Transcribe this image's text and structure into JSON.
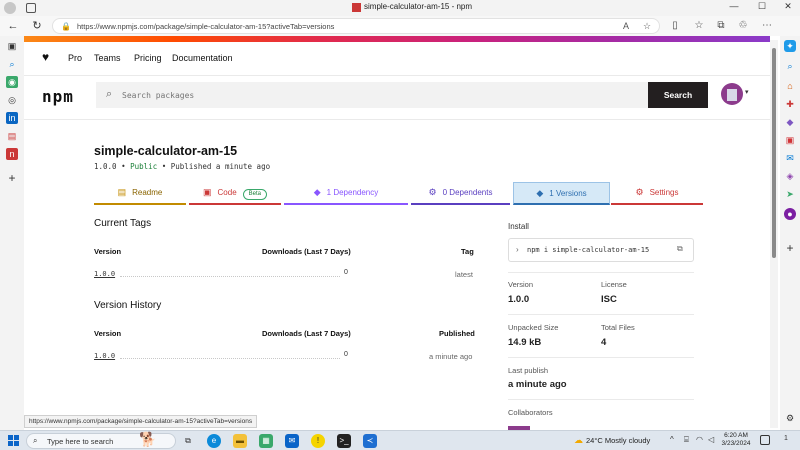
{
  "browser": {
    "tab_title": "simple-calculator-am-15 - npm",
    "url": "https://www.npmjs.com/package/simple-calculator-am-15?activeTab=versions",
    "status_url": "https://www.npmjs.com/package/simple-calculator-am-15?activeTab=versions"
  },
  "npm_nav": {
    "links": [
      "Pro",
      "Teams",
      "Pricing",
      "Documentation"
    ],
    "logo": "npm",
    "search_placeholder": "Search packages",
    "search_button": "Search"
  },
  "package": {
    "name": "simple-calculator-am-15",
    "version": "1.0.0",
    "visibility": "Public",
    "published": "Published a minute ago"
  },
  "tabs": [
    {
      "label": "Readme",
      "icon": "readme-icon",
      "color": "#c28b00"
    },
    {
      "label": "Code",
      "icon": "code-icon",
      "color": "#cb3837",
      "badge": "Beta"
    },
    {
      "label": "1 Dependency",
      "icon": "dependency-icon",
      "color": "#8956ff"
    },
    {
      "label": "0 Dependents",
      "icon": "dependents-icon",
      "color": "#5a3fc0"
    },
    {
      "label": "1 Versions",
      "icon": "versions-icon",
      "color": "#2e6fb0",
      "active": true
    },
    {
      "label": "Settings",
      "icon": "settings-icon",
      "color": "#cb3837"
    }
  ],
  "current_tags": {
    "title": "Current Tags",
    "headers": [
      "Version",
      "Downloads (Last 7 Days)",
      "Tag"
    ],
    "rows": [
      {
        "version": "1.0.0",
        "downloads": "0",
        "tag": "latest"
      }
    ]
  },
  "version_history": {
    "title": "Version History",
    "headers": [
      "Version",
      "Downloads (Last 7 Days)",
      "Published"
    ],
    "rows": [
      {
        "version": "1.0.0",
        "downloads": "0",
        "published": "a minute ago"
      }
    ]
  },
  "sidebar": {
    "install_label": "Install",
    "install_cmd": "npm i simple-calculator-am-15",
    "version_label": "Version",
    "version_value": "1.0.0",
    "license_label": "License",
    "license_value": "ISC",
    "unpacked_label": "Unpacked Size",
    "unpacked_value": "14.9 kB",
    "files_label": "Total Files",
    "files_value": "4",
    "last_publish_label": "Last publish",
    "last_publish_value": "a minute ago",
    "collaborators_label": "Collaborators"
  },
  "taskbar": {
    "search_placeholder": "Type here to search",
    "weather": "24°C  Mostly cloudy",
    "time": "6:20 AM",
    "date": "3/23/2024",
    "notif_count": "1"
  },
  "colors": {
    "npm_red": "#cb3837",
    "active_tab_bg": "#d6e9f7",
    "search_button_bg": "#231f20"
  }
}
